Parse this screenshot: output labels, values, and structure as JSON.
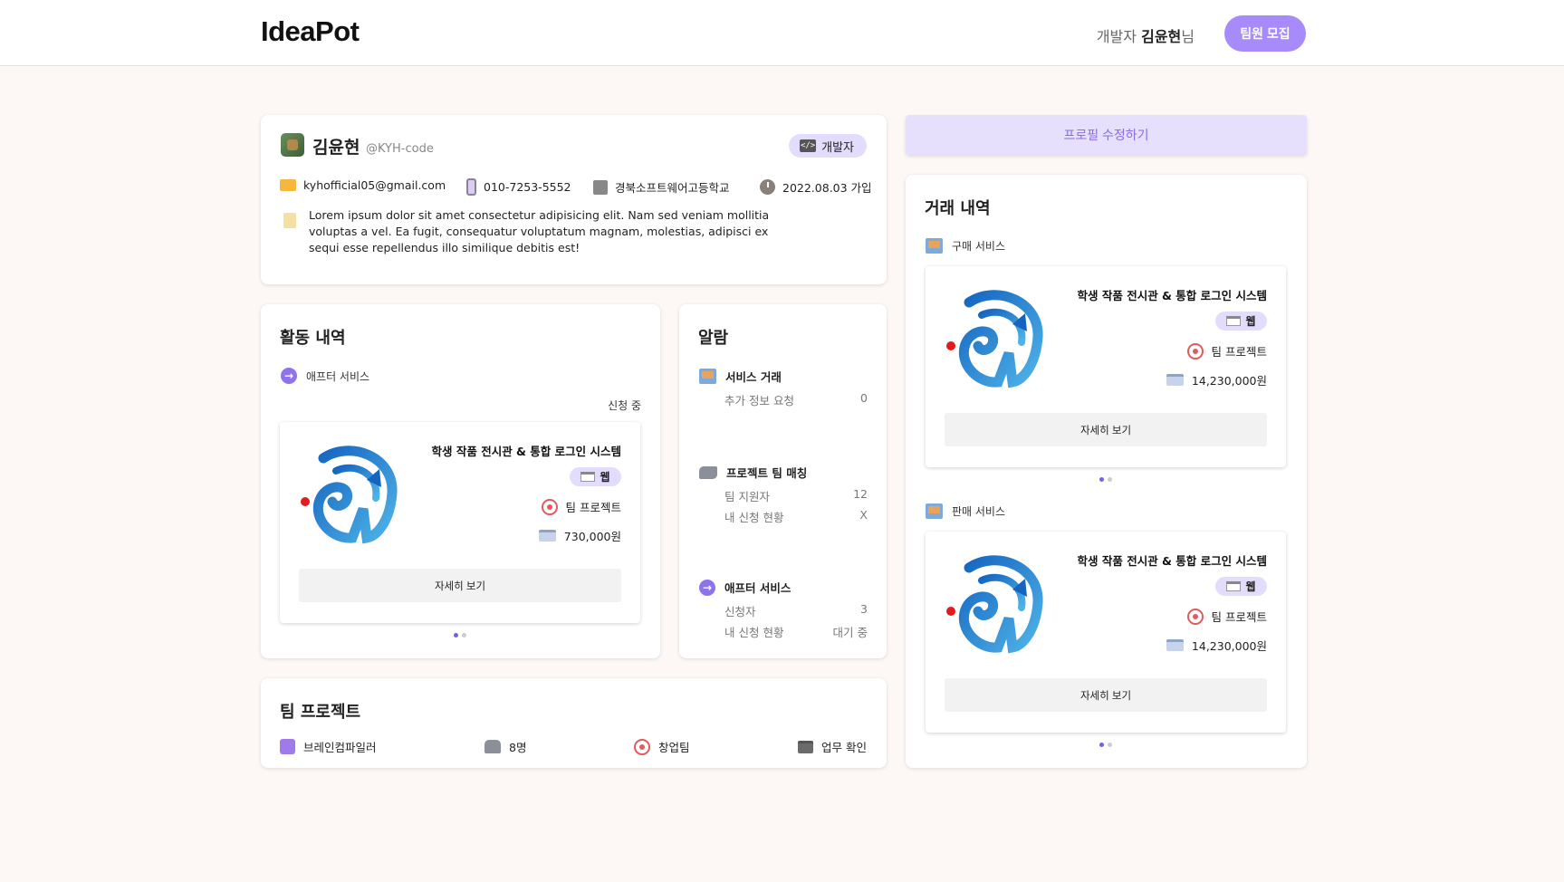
{
  "header": {
    "logo": "IdeaPot",
    "role_prefix": "개발자",
    "user_name": "김윤현",
    "suffix": "님",
    "recruit_button": "팀원 모집"
  },
  "profile": {
    "name": "김윤현",
    "handle": "@KYH-code",
    "role_badge": "개발자",
    "email": "kyhofficial05@gmail.com",
    "phone": "010-7253-5552",
    "school": "경북소프트웨어고등학교",
    "joined": "2022.08.03 가입",
    "bio": "Lorem ipsum dolor sit amet consectetur adipisicing elit. Nam sed veniam mollitia voluptas a vel. Ea fugit, consequatur voluptatum magnam, molestias, adipisci ex sequi esse repellendus illo similique debitis est!"
  },
  "profile_edit_button": "프로필 수정하기",
  "activity": {
    "title": "활동 내역",
    "service_label": "애프터 서비스",
    "status": "신청 중",
    "project": {
      "title": "학생 작품 전시관 & 통합 로그인 시스템",
      "badge": "웹",
      "type": "팀 프로젝트",
      "price": "730,000원",
      "detail_button": "자세히 보기"
    }
  },
  "alarm": {
    "title": "알람",
    "groups": [
      {
        "label": "서비스 거래",
        "rows": [
          {
            "key": "추가 정보 요청",
            "value": "0"
          }
        ]
      },
      {
        "label": "프로젝트 팀 매칭",
        "rows": [
          {
            "key": "팀 지원자",
            "value": "12"
          },
          {
            "key": "내 신청 현황",
            "value": "X"
          }
        ]
      },
      {
        "label": "애프터 서비스",
        "rows": [
          {
            "key": "신청자",
            "value": "3"
          },
          {
            "key": "내 신청 현황",
            "value": "대기 중"
          }
        ]
      }
    ]
  },
  "team_project": {
    "title": "팀 프로젝트",
    "name": "브레인컴파일러",
    "members": "8명",
    "type": "창업팀",
    "action": "업무 확인"
  },
  "transactions": {
    "title": "거래 내역",
    "buy": {
      "label": "구매 서비스",
      "project": {
        "title": "학생 작품 전시관 & 통합 로그인 시스템",
        "badge": "웹",
        "type": "팀 프로젝트",
        "price": "14,230,000원",
        "detail_button": "자세히 보기"
      }
    },
    "sell": {
      "label": "판매 서비스",
      "project": {
        "title": "학생 작품 전시관 & 통합 로그인 시스템",
        "badge": "웹",
        "type": "팀 프로젝트",
        "price": "14,230,000원",
        "detail_button": "자세히 보기"
      }
    }
  },
  "colors": {
    "accent": "#a78bfa",
    "accent_light": "#e4dcfc",
    "background": "#fdf7f6"
  }
}
